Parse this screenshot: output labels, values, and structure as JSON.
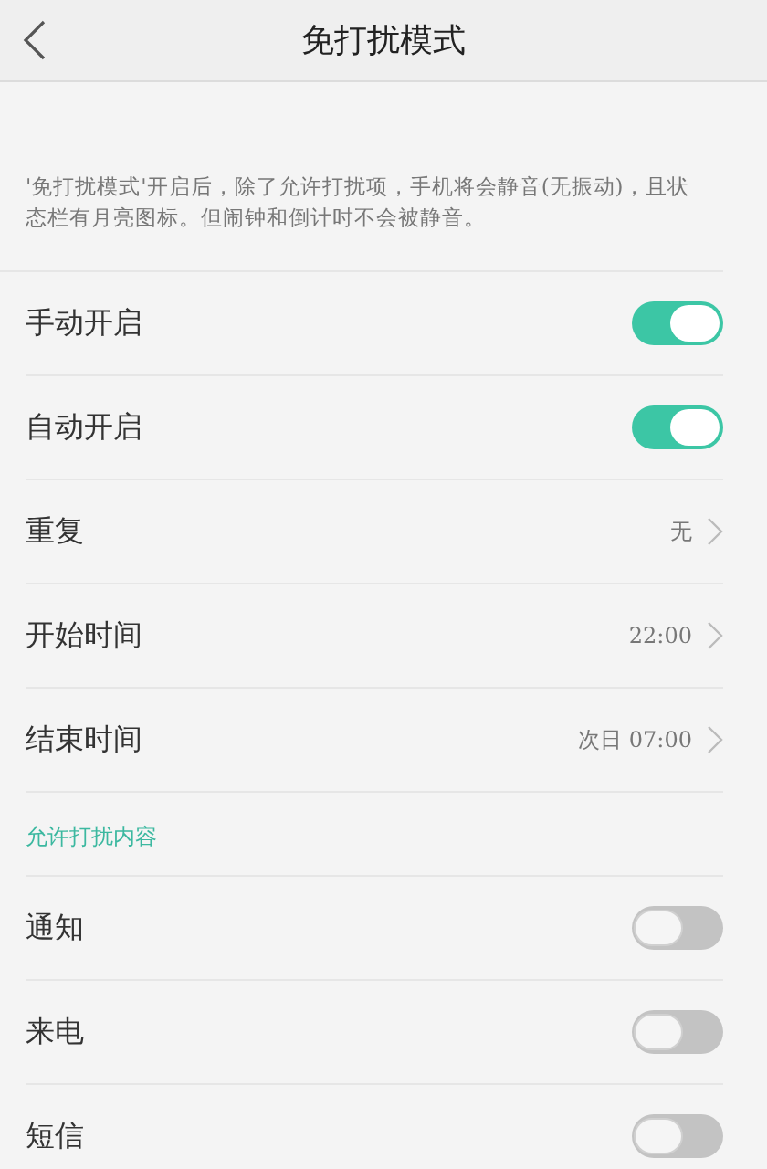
{
  "header": {
    "title": "免打扰模式"
  },
  "description": "'免打扰模式'开启后，除了允许打扰项，手机将会静音(无振动)，且状态栏有月亮图标。但闹钟和倒计时不会被静音。",
  "settings": [
    {
      "kind": "toggle",
      "label": "手动开启",
      "on": true
    },
    {
      "kind": "toggle",
      "label": "自动开启",
      "on": true
    },
    {
      "kind": "value",
      "label": "重复",
      "value": "无"
    },
    {
      "kind": "value",
      "label": "开始时间",
      "value": "22:00"
    },
    {
      "kind": "value",
      "label": "结束时间",
      "value": "次日 07:00"
    }
  ],
  "allowed_section": {
    "title": "允许打扰内容",
    "items": [
      {
        "kind": "toggle",
        "label": "通知",
        "on": false
      },
      {
        "kind": "toggle",
        "label": "来电",
        "on": false
      },
      {
        "kind": "toggle",
        "label": "短信",
        "on": false
      }
    ]
  }
}
